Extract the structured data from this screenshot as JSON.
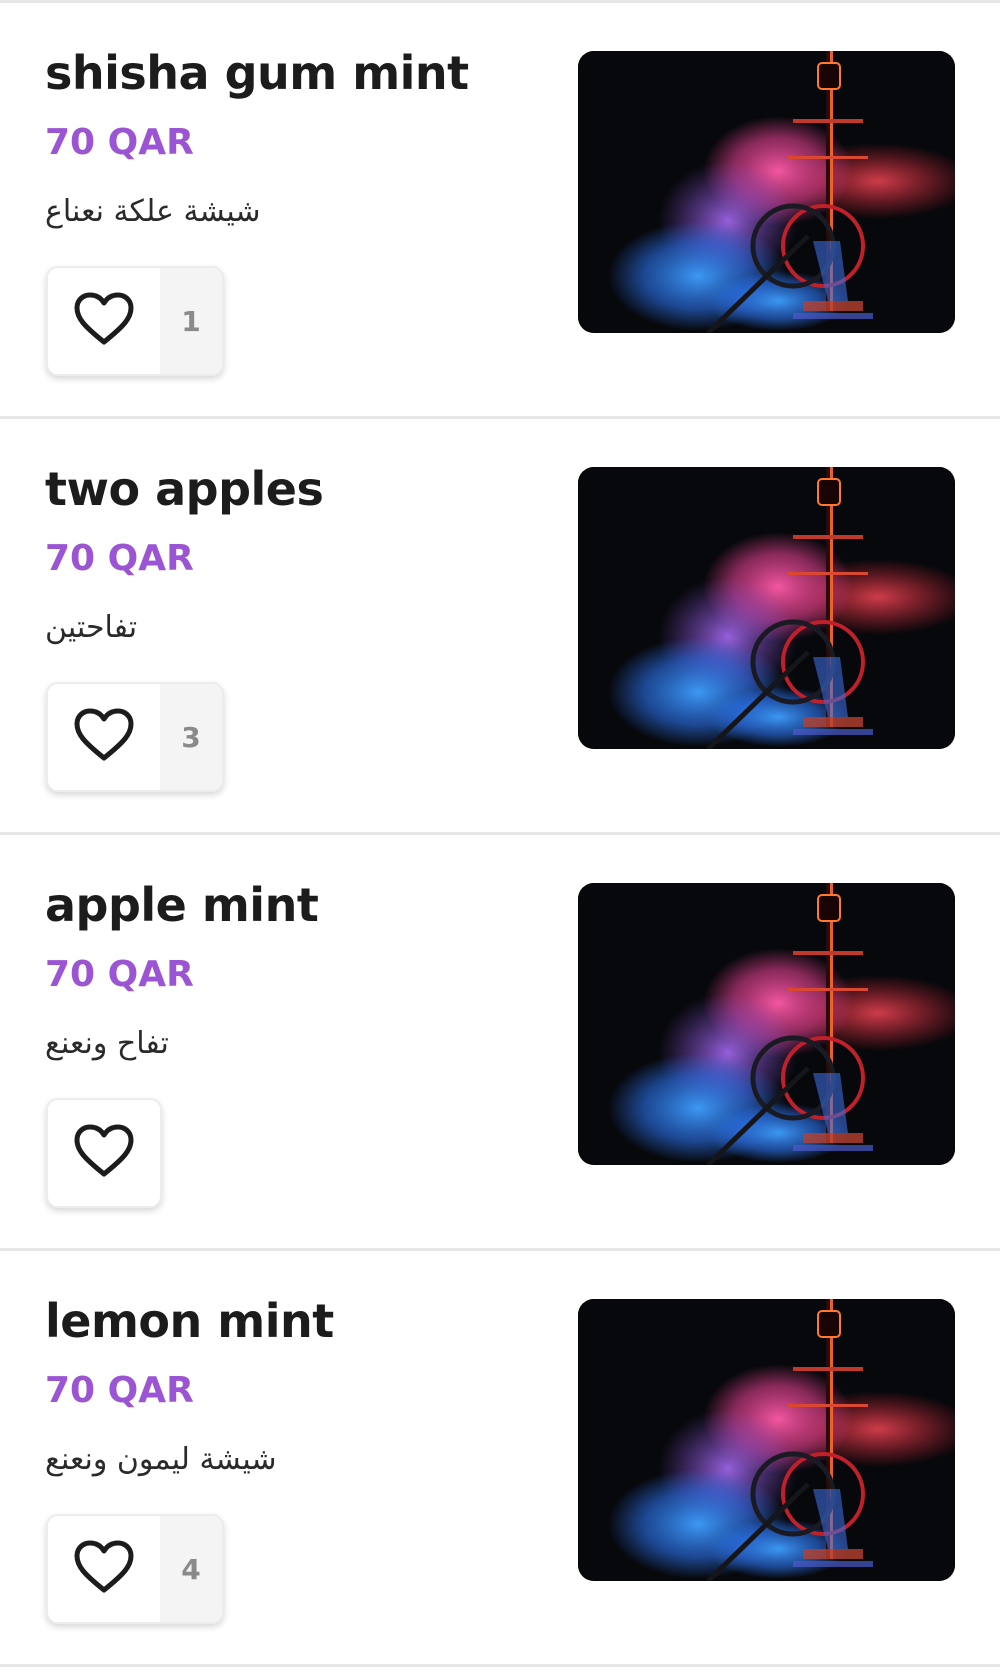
{
  "currency_color": "#9b55d4",
  "items": [
    {
      "name": "shisha gum mint",
      "price": "70 QAR",
      "description": "شيشة علكة نعناع",
      "likes": "1",
      "image_icon": "shisha-hookah-smoke-image"
    },
    {
      "name": "two apples",
      "price": "70 QAR",
      "description": "تفاحتين",
      "likes": "3",
      "image_icon": "shisha-hookah-smoke-image"
    },
    {
      "name": "apple mint",
      "price": "70 QAR",
      "description": "تفاح ونعنع",
      "likes": "",
      "image_icon": "shisha-hookah-smoke-image"
    },
    {
      "name": "lemon mint",
      "price": "70 QAR",
      "description": "شيشة ليمون ونعنع",
      "likes": "4",
      "image_icon": "shisha-hookah-smoke-image"
    }
  ]
}
